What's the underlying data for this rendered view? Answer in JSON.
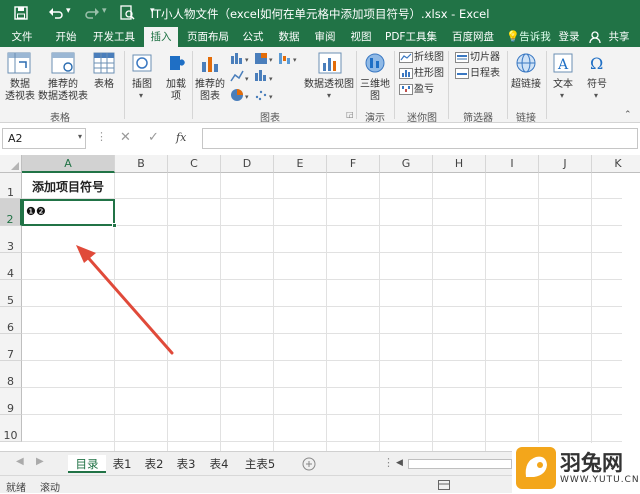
{
  "window": {
    "title": "IT小人物文件（excel如何在单元格中添加项目符号）.xlsx - Excel",
    "save_icon": "save-icon",
    "undo_icon": "undo-icon",
    "redo_icon": "redo-icon",
    "preview_icon": "print-preview-icon"
  },
  "tabs": [
    "文件",
    "开始",
    "开发工具",
    "插入",
    "页面布局",
    "公式",
    "数据",
    "审阅",
    "视图",
    "PDF工具集",
    "百度网盘"
  ],
  "tab_active": "插入",
  "tellme": "告诉我",
  "login": "登录",
  "share": "共享",
  "ribbon": {
    "pivot": "数据\n透视表",
    "recommended_pivot": "推荐的\n数据透视表",
    "table": "表格",
    "group_tables": "表格",
    "illustrations": "插图",
    "addins": "加载\n项",
    "rec_charts": "推荐的\n图表",
    "pivot_chart": "数据透视图",
    "group_charts": "图表",
    "map3d": "三维地\n图",
    "group_tours": "演示",
    "sl_line": "折线图",
    "sl_col": "柱形图",
    "sl_winloss": "盈亏",
    "group_spark": "迷你图",
    "slicer": "切片器",
    "timeline": "日程表",
    "group_filters": "筛选器",
    "hyperlink": "超链接",
    "group_links": "链接",
    "text": "文本",
    "symbol": "符号"
  },
  "namebox": "A2",
  "fx": "fx",
  "columns": [
    "A",
    "B",
    "C",
    "D",
    "E",
    "F",
    "G",
    "H",
    "I",
    "J",
    "K"
  ],
  "rows": [
    "1",
    "2",
    "3",
    "4",
    "5",
    "6",
    "7",
    "8",
    "9",
    "10"
  ],
  "cells": {
    "A1": "添加项目符号",
    "A2": "❶❷"
  },
  "sheets": [
    "目录",
    "表1",
    "表2",
    "表3",
    "表4",
    "主表5"
  ],
  "active_sheet": "目录",
  "status": {
    "ready": "就绪",
    "scroll": "滚动"
  },
  "watermark": {
    "text": "羽兔网",
    "url": "WWW.YUTU.CN"
  }
}
